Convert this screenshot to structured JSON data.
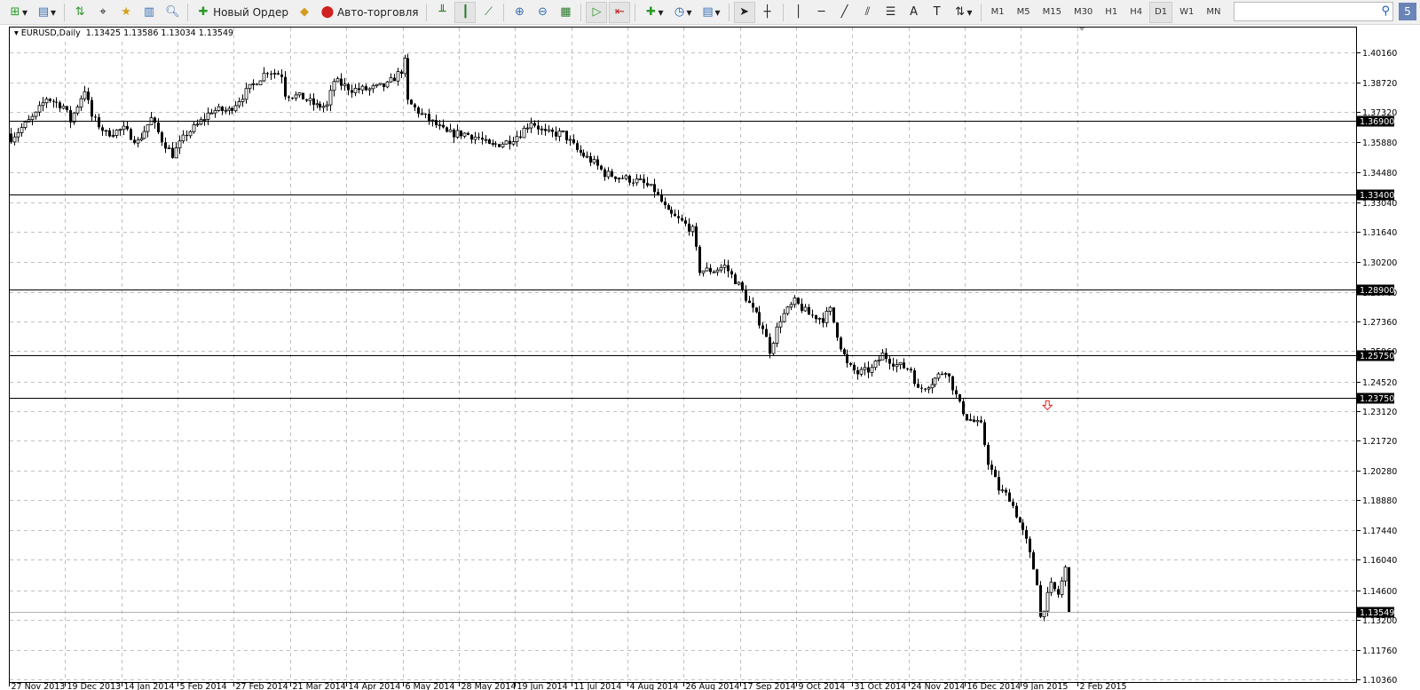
{
  "toolbar": {
    "new_order": "Новый Ордер",
    "auto_trading": "Авто-торговля",
    "timeframes": [
      "M1",
      "M5",
      "M15",
      "M30",
      "H1",
      "H4",
      "D1",
      "W1",
      "MN"
    ],
    "active_timeframe": "D1",
    "search_placeholder": "",
    "notifications": "5"
  },
  "chart_data": {
    "type": "candlestick",
    "symbol_label": "EURUSD,Daily",
    "ohlc": [
      "1.13425",
      "1.13586",
      "1.13034",
      "1.13549"
    ],
    "y_ticks": [
      "1.40160",
      "1.38720",
      "1.37320",
      "1.35880",
      "1.34480",
      "1.33040",
      "1.31640",
      "1.30200",
      "1.28760",
      "1.27360",
      "1.25960",
      "1.24520",
      "1.23120",
      "1.21720",
      "1.20280",
      "1.18880",
      "1.17440",
      "1.16040",
      "1.14600",
      "1.13200",
      "1.11760",
      "1.10360"
    ],
    "ylim": [
      1.1036,
      1.4016
    ],
    "x_ticks": [
      "27 Nov 2013",
      "19 Dec 2013",
      "14 Jan 2014",
      "5 Feb 2014",
      "27 Feb 2014",
      "21 Mar 2014",
      "14 Apr 2014",
      "6 May 2014",
      "28 May 2014",
      "19 Jun 2014",
      "11 Jul 2014",
      "4 Aug 2014",
      "26 Aug 2014",
      "17 Sep 2014",
      "9 Oct 2014",
      "31 Oct 2014",
      "24 Nov 2014",
      "16 Dec 2014",
      "9 Jan 2015",
      "2 Feb 2015"
    ],
    "bars_per_tick": 16,
    "levels": [
      "1.36900",
      "1.33400",
      "1.28900",
      "1.25750",
      "1.23750"
    ],
    "bid": "1.13549",
    "sell_arrow_price": 1.2368,
    "sell_arrow_bar": 295,
    "anchor_closes": [
      [
        0,
        1.361
      ],
      [
        7,
        1.372
      ],
      [
        10,
        1.38
      ],
      [
        15,
        1.376
      ],
      [
        17,
        1.369
      ],
      [
        21,
        1.384
      ],
      [
        23,
        1.371
      ],
      [
        27,
        1.363
      ],
      [
        32,
        1.365
      ],
      [
        36,
        1.359
      ],
      [
        40,
        1.37
      ],
      [
        43,
        1.36
      ],
      [
        46,
        1.353
      ],
      [
        50,
        1.363
      ],
      [
        53,
        1.367
      ],
      [
        57,
        1.374
      ],
      [
        62,
        1.374
      ],
      [
        66,
        1.381
      ],
      [
        70,
        1.388
      ],
      [
        73,
        1.393
      ],
      [
        77,
        1.391
      ],
      [
        78,
        1.382
      ],
      [
        83,
        1.38
      ],
      [
        87,
        1.376
      ],
      [
        90,
        1.376
      ],
      [
        92,
        1.388
      ],
      [
        97,
        1.384
      ],
      [
        102,
        1.384
      ],
      [
        107,
        1.386
      ],
      [
        111,
        1.393
      ],
      [
        112,
        1.397
      ],
      [
        113,
        1.378
      ],
      [
        117,
        1.372
      ],
      [
        121,
        1.367
      ],
      [
        124,
        1.363
      ],
      [
        129,
        1.363
      ],
      [
        133,
        1.361
      ],
      [
        136,
        1.357
      ],
      [
        141,
        1.359
      ],
      [
        145,
        1.363
      ],
      [
        148,
        1.369
      ],
      [
        152,
        1.363
      ],
      [
        157,
        1.363
      ],
      [
        161,
        1.355
      ],
      [
        166,
        1.349
      ],
      [
        169,
        1.344
      ],
      [
        174,
        1.342
      ],
      [
        179,
        1.34
      ],
      [
        183,
        1.336
      ],
      [
        187,
        1.325
      ],
      [
        191,
        1.321
      ],
      [
        194,
        1.317
      ],
      [
        196,
        1.298
      ],
      [
        200,
        1.298
      ],
      [
        203,
        1.3
      ],
      [
        207,
        1.291
      ],
      [
        211,
        1.279
      ],
      [
        214,
        1.271
      ],
      [
        216,
        1.26
      ],
      [
        219,
        1.275
      ],
      [
        223,
        1.283
      ],
      [
        227,
        1.277
      ],
      [
        231,
        1.275
      ],
      [
        233,
        1.279
      ],
      [
        236,
        1.262
      ],
      [
        238,
        1.253
      ],
      [
        241,
        1.249
      ],
      [
        245,
        1.251
      ],
      [
        248,
        1.258
      ],
      [
        252,
        1.253
      ],
      [
        256,
        1.251
      ],
      [
        258,
        1.241
      ],
      [
        262,
        1.245
      ],
      [
        266,
        1.251
      ],
      [
        267,
        1.247
      ],
      [
        270,
        1.234
      ],
      [
        272,
        1.228
      ],
      [
        276,
        1.224
      ],
      [
        278,
        1.207
      ],
      [
        281,
        1.194
      ],
      [
        284,
        1.19
      ],
      [
        287,
        1.178
      ],
      [
        289,
        1.169
      ],
      [
        292,
        1.15
      ],
      [
        293,
        1.133
      ],
      [
        296,
        1.148
      ],
      [
        298,
        1.144
      ],
      [
        300,
        1.156
      ],
      [
        301,
        1.1355
      ]
    ]
  }
}
